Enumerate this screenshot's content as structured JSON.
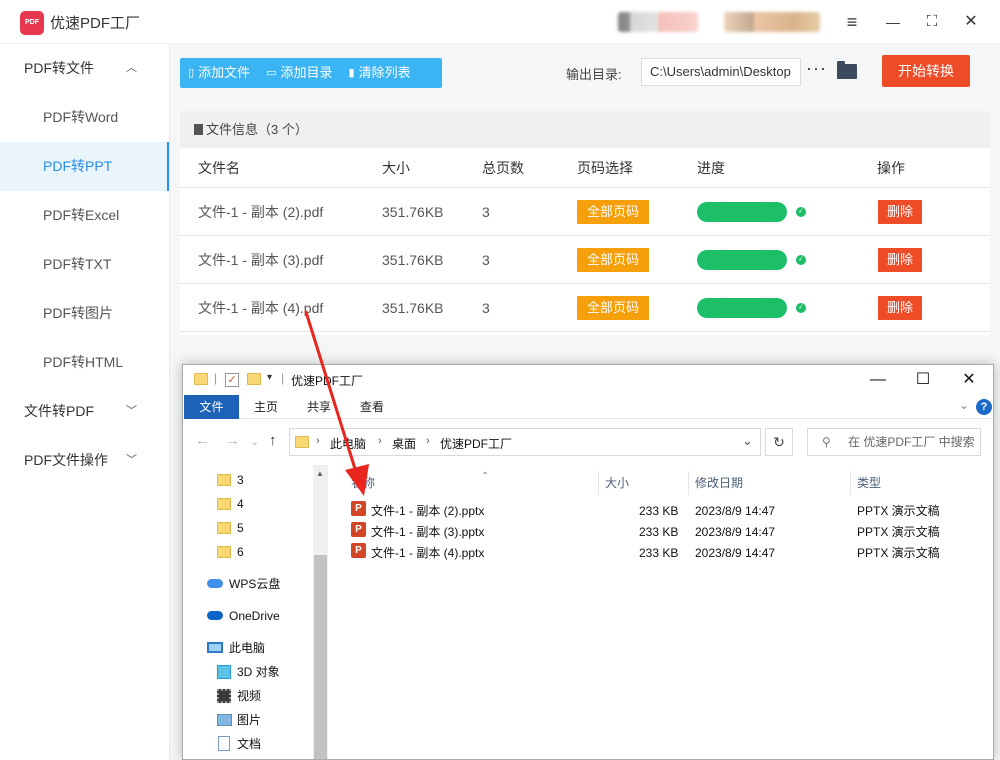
{
  "app": {
    "logo_text": "PDF",
    "title": "优速PDF工厂"
  },
  "window_controls": {
    "menu": "≡",
    "minimize": "—",
    "maximize": "⛶",
    "close": "✕"
  },
  "sidebar": {
    "groups": [
      {
        "label": "PDF转文件",
        "expanded": true,
        "items": [
          "PDF转Word",
          "PDF转PPT",
          "PDF转Excel",
          "PDF转TXT",
          "PDF转图片",
          "PDF转HTML"
        ]
      },
      {
        "label": "文件转PDF",
        "expanded": false
      },
      {
        "label": "PDF文件操作",
        "expanded": false
      }
    ],
    "active_item": "PDF转PPT"
  },
  "toolbar": {
    "add_file": "添加文件",
    "add_folder": "添加目录",
    "clear_list": "清除列表",
    "output_label": "输出目录:",
    "output_path": "C:\\Users\\admin\\Desktop",
    "more": "···",
    "start": "开始转换"
  },
  "file_panel": {
    "header": "文件信息（3 个）",
    "columns": [
      "文件名",
      "大小",
      "总页数",
      "页码选择",
      "进度",
      "操作"
    ],
    "rows": [
      {
        "name": "文件-1 - 副本 (2).pdf",
        "size": "351.76KB",
        "pages": "3",
        "page_select": "全部页码",
        "progress": 1.0,
        "action": "删除"
      },
      {
        "name": "文件-1 - 副本 (3).pdf",
        "size": "351.76KB",
        "pages": "3",
        "page_select": "全部页码",
        "progress": 1.0,
        "action": "删除"
      },
      {
        "name": "文件-1 - 副本 (4).pdf",
        "size": "351.76KB",
        "pages": "3",
        "page_select": "全部页码",
        "progress": 1.0,
        "action": "删除"
      }
    ]
  },
  "explorer": {
    "title": "优速PDF工厂",
    "ribbon": [
      "文件",
      "主页",
      "共享",
      "查看"
    ],
    "address": [
      "此电脑",
      "桌面",
      "优速PDF工厂"
    ],
    "search_placeholder": "在 优速PDF工厂 中搜索",
    "tree": [
      "3",
      "4",
      "5",
      "6",
      "WPS云盘",
      "OneDrive",
      "此电脑",
      "3D 对象",
      "视频",
      "图片",
      "文档"
    ],
    "columns": [
      "名称",
      "大小",
      "修改日期",
      "类型"
    ],
    "files": [
      {
        "name": "文件-1 - 副本 (2).pptx",
        "size": "233 KB",
        "date": "2023/8/9 14:47",
        "type": "PPTX 演示文稿"
      },
      {
        "name": "文件-1 - 副本 (3).pptx",
        "size": "233 KB",
        "date": "2023/8/9 14:47",
        "type": "PPTX 演示文稿"
      },
      {
        "name": "文件-1 - 副本 (4).pptx",
        "size": "233 KB",
        "date": "2023/8/9 14:47",
        "type": "PPTX 演示文稿"
      }
    ]
  },
  "colors": {
    "accent_blue": "#3ab4f2",
    "start_red": "#ee4b27",
    "page_orange": "#f59f0b",
    "progress_green": "#1dbe68",
    "arrow_red": "#e8261e"
  }
}
